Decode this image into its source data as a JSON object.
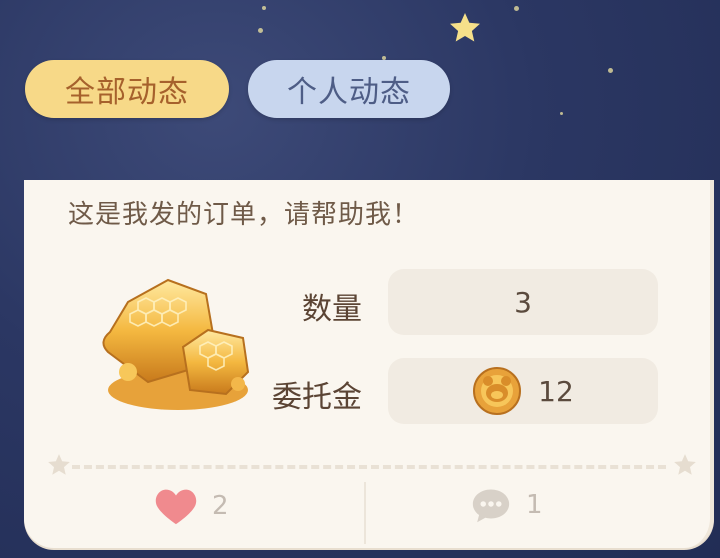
{
  "tabs": [
    {
      "label": "全部动态",
      "active": true
    },
    {
      "label": "个人动态",
      "active": false
    }
  ],
  "card": {
    "message": "这是我发的订单，请帮助我！",
    "item_icon": "honeycomb-icon",
    "quantity_label": "数量",
    "quantity_value": "3",
    "reward_label": "委托金",
    "reward_value": "12",
    "reward_icon": "bear-coin-icon"
  },
  "actions": {
    "likes": "2",
    "comments": "1"
  },
  "colors": {
    "sky": "#2b3763",
    "tab_active_bg": "#f7d988",
    "tab_active_text": "#a6612c",
    "tab_inactive_bg": "#c8d6ee",
    "tab_inactive_text": "#4e5d86",
    "card_bg": "#faf6ef",
    "heart": "#f08a8e"
  }
}
